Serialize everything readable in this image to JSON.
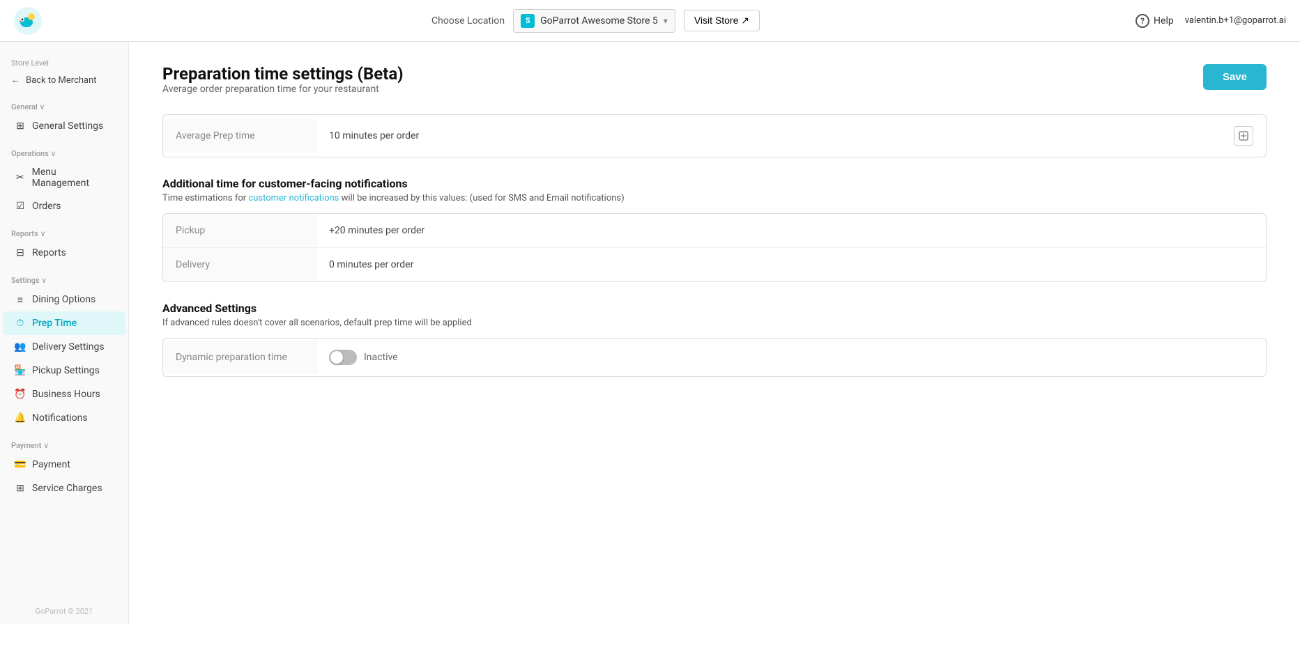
{
  "header": {
    "choose_location_label": "Choose Location",
    "location_icon_letter": "S",
    "location_name": "GoParrot Awesome Store 5",
    "visit_store_label": "Visit Store ↗",
    "help_label": "Help",
    "user_email": "valentin.b+1@goparrot.ai"
  },
  "sidebar": {
    "store_level_label": "Store Level",
    "back_to_merchant_label": "Back to Merchant",
    "general_section": "General ∨",
    "general_settings_label": "General Settings",
    "operations_section": "Operations ∨",
    "menu_management_label": "Menu Management",
    "orders_label": "Orders",
    "reports_section": "Reports ∨",
    "reports_label": "Reports",
    "settings_section": "Settings ∨",
    "dining_options_label": "Dining Options",
    "prep_time_label": "Prep Time",
    "delivery_settings_label": "Delivery Settings",
    "pickup_settings_label": "Pickup Settings",
    "business_hours_label": "Business Hours",
    "notifications_label": "Notifications",
    "payment_section": "Payment ∨",
    "payment_label": "Payment",
    "service_charges_label": "Service Charges",
    "footer": "GoParrot © 2021"
  },
  "page": {
    "title": "Preparation time settings (Beta)",
    "subtitle": "Average order preparation time for your restaurant",
    "save_label": "Save"
  },
  "average_prep": {
    "label": "Average Prep time",
    "value": "10 minutes per order"
  },
  "notifications_section": {
    "title": "Additional time for customer-facing notifications",
    "desc_plain": "Time estimations for ",
    "desc_link": "customer notifications",
    "desc_rest": " will be increased by this values: (used for SMS and Email notifications)"
  },
  "notification_rows": [
    {
      "label": "Pickup",
      "value": "+20 minutes per order"
    },
    {
      "label": "Delivery",
      "value": "0 minutes per order"
    }
  ],
  "advanced_section": {
    "title": "Advanced Settings",
    "desc": "If advanced rules doesn't cover all scenarios, default prep time will be applied"
  },
  "dynamic_prep": {
    "label": "Dynamic preparation time",
    "status": "Inactive",
    "active": false
  }
}
